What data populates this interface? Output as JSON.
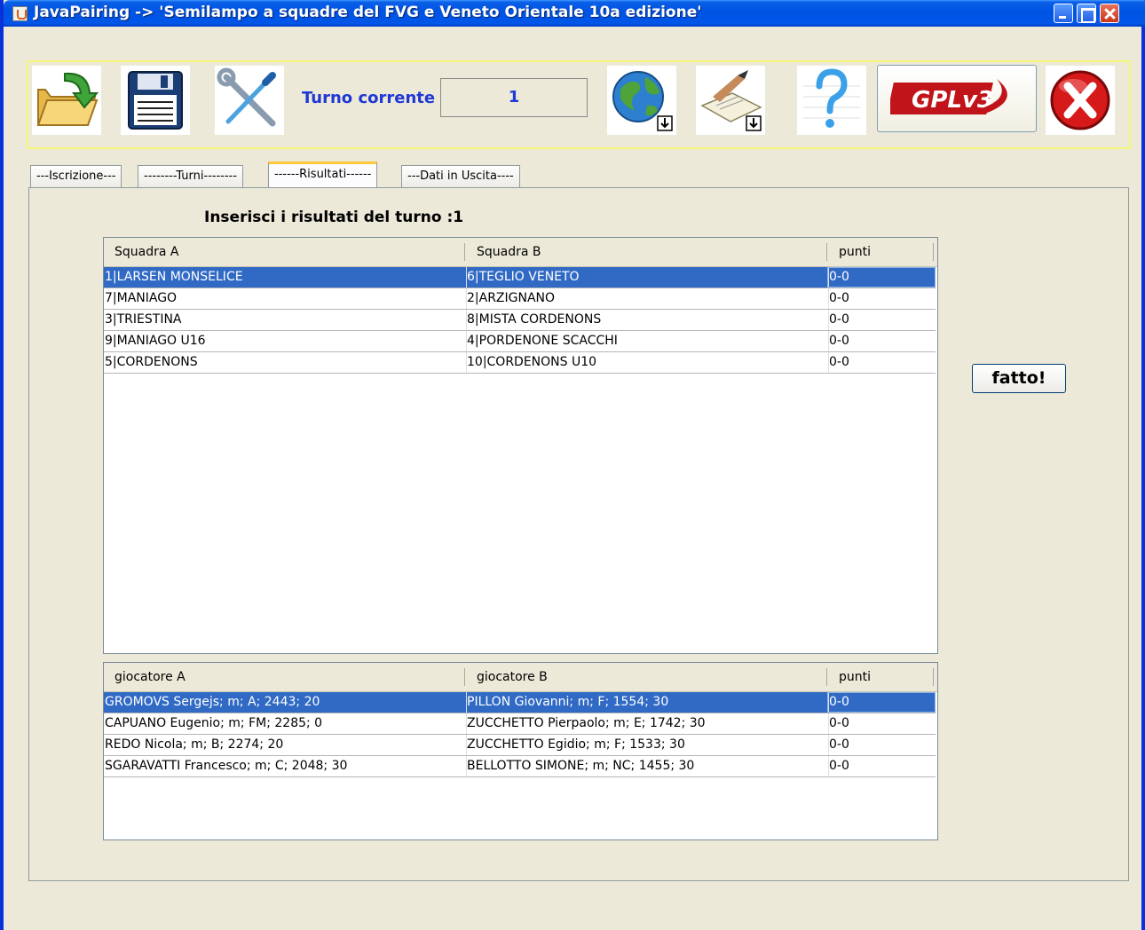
{
  "window": {
    "title": "JavaPairing -> 'Semilampo a squadre del FVG e Veneto Orientale 10a edizione'"
  },
  "toolbar": {
    "icons": [
      "open-folder-icon",
      "save-floppy-icon",
      "tools-icon",
      "globe-export-icon",
      "document-export-icon",
      "help-icon",
      "gpl-logo",
      "exit-icon"
    ],
    "turno_label": "Turno corrente",
    "turno_value": "1",
    "gpl_text": "GPLv3"
  },
  "tabs": [
    {
      "label": "---Iscrizione---"
    },
    {
      "label": "--------Turni--------"
    },
    {
      "label": "------Risultati------",
      "active": true
    },
    {
      "label": "---Dati in Uscita----"
    }
  ],
  "results": {
    "heading": "Inserisci i risultati del turno :1",
    "done_button": "fatto!",
    "teams": {
      "columns": [
        "Squadra A",
        "Squadra B",
        "punti"
      ],
      "rows": [
        [
          "1|LARSEN MONSELICE",
          "6|TEGLIO VENETO",
          "0-0"
        ],
        [
          "7|MANIAGO",
          "2|ARZIGNANO",
          "0-0"
        ],
        [
          "3|TRIESTINA",
          "8|MISTA CORDENONS",
          "0-0"
        ],
        [
          "9|MANIAGO U16",
          "4|PORDENONE SCACCHI",
          "0-0"
        ],
        [
          "5|CORDENONS",
          "10|CORDENONS U10",
          "0-0"
        ]
      ],
      "selected_row": 0
    },
    "players": {
      "columns": [
        "giocatore A",
        "giocatore B",
        "punti"
      ],
      "rows": [
        [
          "GROMOVS Sergejs; m; A; 2443; 20",
          "PILLON Giovanni; m; F; 1554; 30",
          "0-0"
        ],
        [
          "CAPUANO Eugenio; m; FM; 2285; 0",
          "ZUCCHETTO Pierpaolo; m; E; 1742; 30",
          "0-0"
        ],
        [
          "REDO Nicola; m; B; 2274; 20",
          "ZUCCHETTO Egidio; m; F; 1533; 30",
          "0-0"
        ],
        [
          "SGARAVATTI Francesco; m; C; 2048; 30",
          "BELLOTTO SIMONE; m; NC; 1455; 30",
          "0-0"
        ]
      ],
      "selected_row": 0
    }
  },
  "colors": {
    "titlebar": "#0054e3",
    "selection": "#316ac5",
    "accent_text": "#1f38d6"
  }
}
